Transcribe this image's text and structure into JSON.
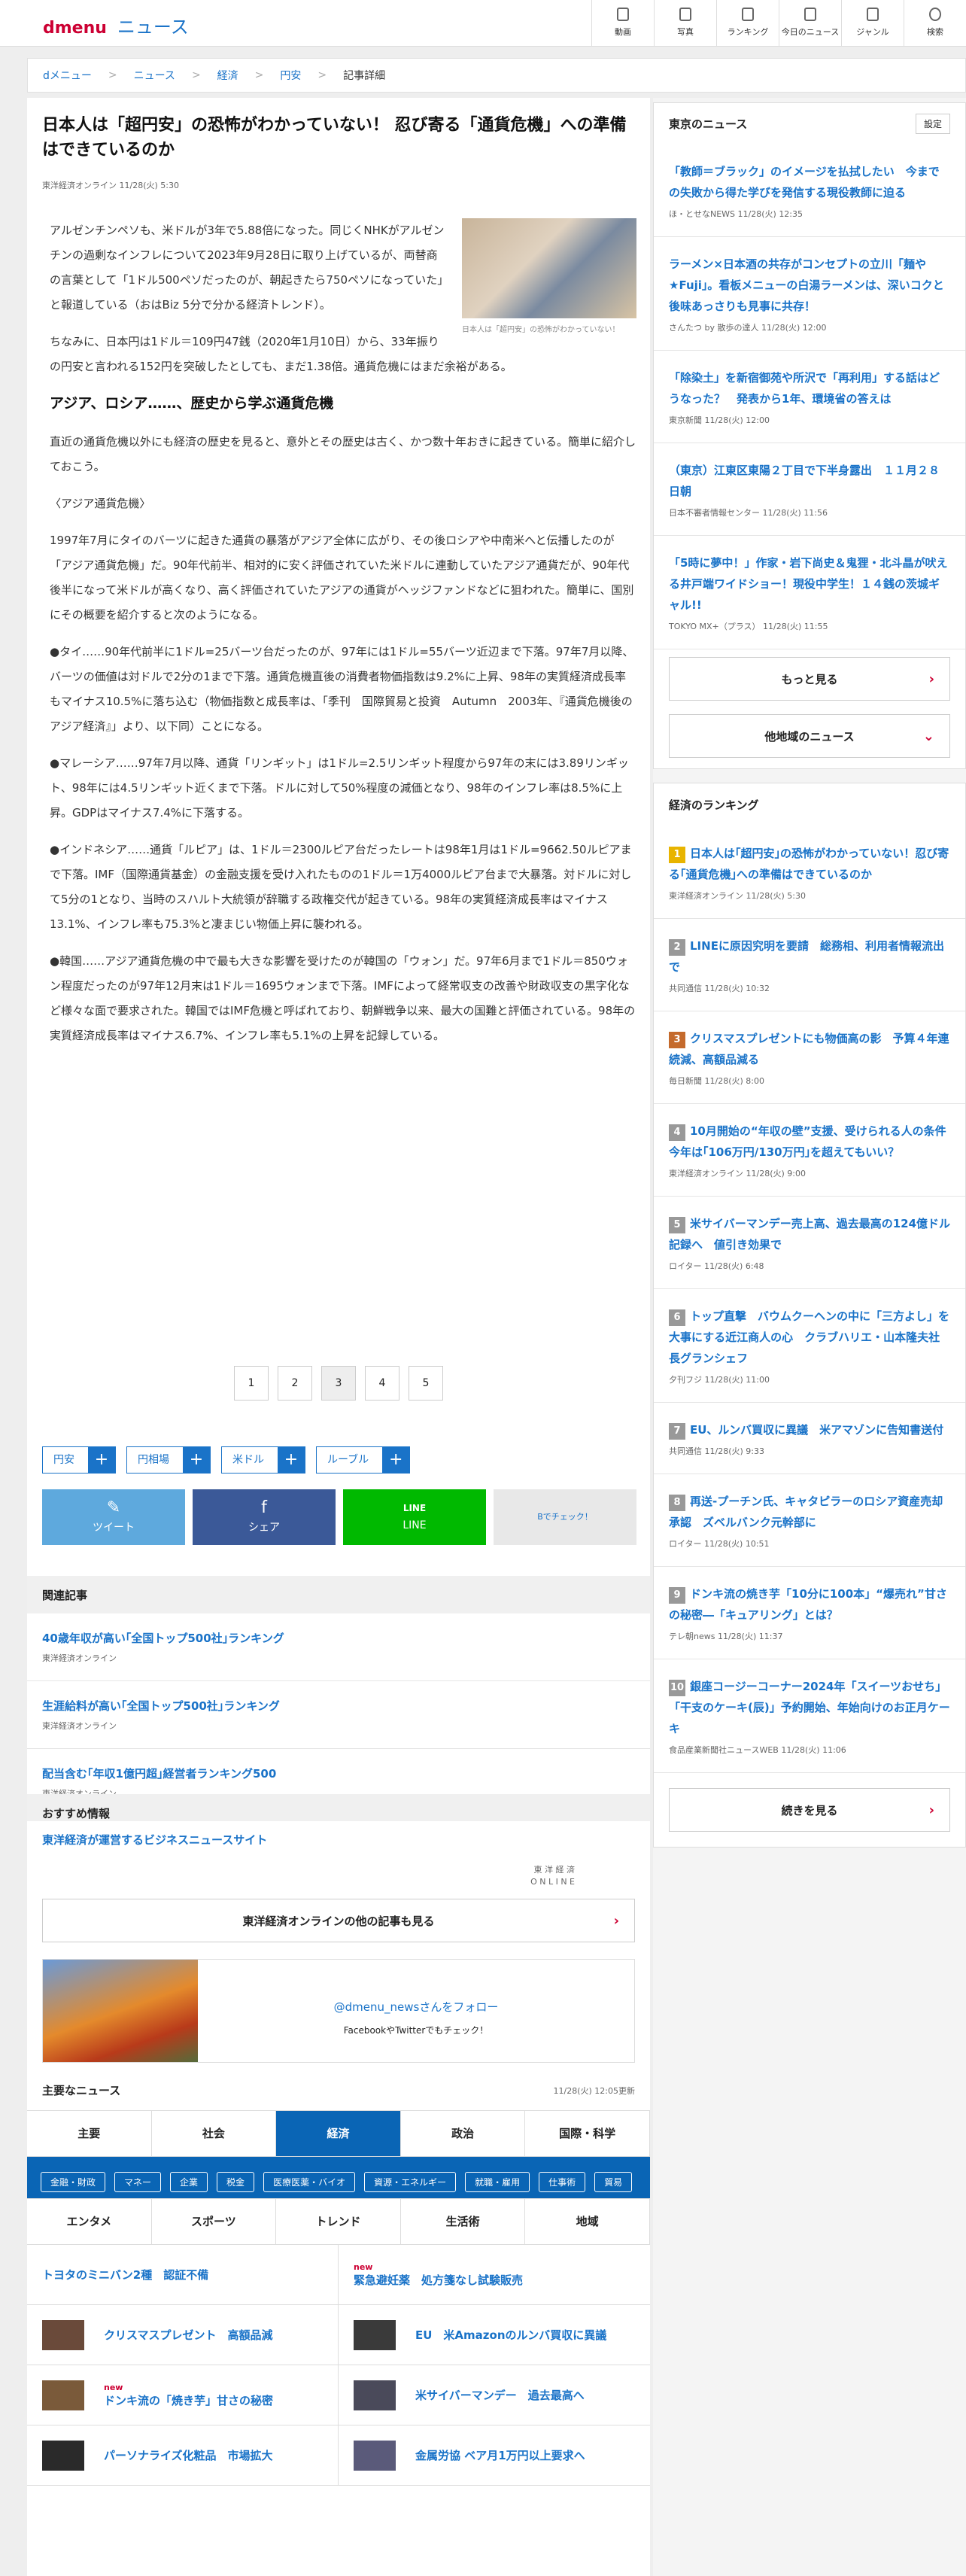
{
  "header": {
    "logo_d": "d",
    "logo_menu": "menu",
    "logo_news": "ニュース",
    "nav": [
      "動画",
      "写真",
      "ランキング",
      "今日のニュース",
      "ジャンル",
      "検索"
    ]
  },
  "breadcrumb": [
    "dメニュー",
    "ニュース",
    "経済",
    "円安",
    "記事詳細"
  ],
  "article": {
    "title": "日本人は「超円安」の恐怖がわかっていない！ 忍び寄る「通貨危機」への準備はできているのか",
    "source": "東洋経済オンライン 11/28(火) 5:30",
    "figcap": "日本人は「超円安」の恐怖がわかっていない！",
    "p1": "アルゼンチンペソも、米ドルが3年で5.88倍になった。同じくNHKがアルゼンチンの過剰なインフレについて2023年9月28日に取り上げているが、両替商の言葉として「1ドル500ペソだったのが、朝起きたら750ペソになっていた」と報道している（おはBiz 5分で分かる経済トレンド）。",
    "p2": "ちなみに、日本円は1ドル＝109円47銭（2020年1月10日）から、33年振りの円安と言われる152円を突破したとしても、まだ1.38倍。通貨危機にはまだ余裕がある。",
    "h2": "アジア、ロシア……、歴史から学ぶ通貨危機",
    "p3": "直近の通貨危機以外にも経済の歴史を見ると、意外とその歴史は古く、かつ数十年おきに起きている。簡単に紹介しておこう。",
    "p4": "〈アジア通貨危機〉",
    "p5": "1997年7月にタイのバーツに起きた通貨の暴落がアジア全体に広がり、その後ロシアや中南米へと伝播したのが「アジア通貨危機」だ。90年代前半、相対的に安く評価されていた米ドルに連動していたアジア通貨だが、90年代後半になって米ドルが高くなり、高く評価されていたアジアの通貨がヘッジファンドなどに狙われた。簡単に、国別にその概要を紹介すると次のようになる。",
    "p6": "●タイ……90年代前半に1ドル=25バーツ台だったのが、97年には1ドル=55バーツ近辺まで下落。97年7月以降、バーツの価値は対ドルで2分の1まで下落。通貨危機直後の消費者物価指数は9.2%に上昇、98年の実質経済成長率もマイナス10.5%に落ち込む（物価指数と成長率は、「季刊　国際貿易と投資　Autumn　2003年、『通貨危機後のアジア経済』」より、以下同）ことになる。",
    "p7": "●マレーシア……97年7月以降、通貨「リンギット」は1ドル=2.5リンギット程度から97年の末には3.89リンギット、98年には4.5リンギット近くまで下落。ドルに対して50%程度の減価となり、98年のインフレ率は8.5%に上昇。GDPはマイナス7.4%に下落する。",
    "p8": "●インドネシア……通貨「ルピア」は、1ドル＝2300ルピア台だったレートは98年1月は1ドル=9662.50ルピアまで下落。IMF（国際通貨基金）の金融支援を受け入れたものの1ドル＝1万4000ルピア台まで大暴落。対ドルに対して5分の1となり、当時のスハルト大統領が辞職する政権交代が起きている。98年の実質経済成長率はマイナス13.1%、インフレ率も75.3%と凄まじい物価上昇に襲われる。",
    "p9": "●韓国……アジア通貨危機の中で最も大きな影響を受けたのが韓国の「ウォン」だ。97年6月まで1ドル＝850ウォン程度だったのが97年12月末は1ドル＝1695ウォンまで下落。IMFによって経常収支の改善や財政収支の黒字化など様々な面で要求された。韓国ではIMF危機と呼ばれており、朝鮮戦争以来、最大の国難と評価されている。98年の実質経済成長率はマイナス6.7%、インフレ率も5.1%の上昇を記録している。"
  },
  "pager": [
    "1",
    "2",
    "3",
    "4",
    "5"
  ],
  "tags": [
    "円安",
    "円相場",
    "米ドル",
    "ルーブル"
  ],
  "share": {
    "tweet": "ツイート",
    "share": "シェア",
    "line": "LINE",
    "check": "Bでチェック！",
    "line_glyph": "LINE"
  },
  "related": {
    "heading": "関連記事",
    "items": [
      {
        "title": "40歳年収が高い｢全国トップ500社｣ランキング",
        "src": "東洋経済オンライン"
      },
      {
        "title": "生涯給料が高い｢全国トップ500社｣ランキング",
        "src": "東洋経済オンライン"
      },
      {
        "title": "配当含む｢年収1億円超｣経営者ランキング500",
        "src": "東洋経済オンライン"
      }
    ]
  },
  "reco": {
    "heading": "おすすめ情報",
    "link": "東洋経済が運営するビジネスニュースサイト",
    "logo": "東 洋 経 済\nO N L I N E",
    "more": "東洋経済オンラインの他の記事も見る",
    "follow": "@dmenu_newsさんをフォロー",
    "follow_sub": "FacebookやTwitterでもチェック！"
  },
  "major": {
    "heading": "主要なニュース",
    "updated": "11/28(火) 12:05更新",
    "cats1": [
      "主要",
      "社会",
      "経済",
      "政治",
      "国際・科学"
    ],
    "subtags": [
      "金融・財政",
      "マネー",
      "企業",
      "税金",
      "医療医薬・バイオ",
      "資源・エネルギー",
      "就職・雇用",
      "仕事術",
      "貿易"
    ],
    "cats2": [
      "エンタメ",
      "スポーツ",
      "トレンド",
      "生活術",
      "地域"
    ],
    "news": [
      {
        "t": "トヨタのミニバン2種　認証不備",
        "n": ""
      },
      {
        "t": "緊急避妊薬　処方箋なし試験販売",
        "n": "new"
      },
      {
        "t": "クリスマスプレゼント　高額品減",
        "n": ""
      },
      {
        "t": "EU　米Amazonのルンバ買収に異議",
        "n": ""
      },
      {
        "t": "ドンキ流の「焼き芋」甘さの秘密",
        "n": "new"
      },
      {
        "t": "米サイバーマンデー　過去最高へ",
        "n": ""
      },
      {
        "t": "パーソナライズ化粧品　市場拡大",
        "n": ""
      },
      {
        "t": "金属労協 ベア月1万円以上要求へ",
        "n": ""
      }
    ]
  },
  "side": {
    "tokyo_heading": "東京のニュース",
    "setting": "設定",
    "tokyo": [
      {
        "t": "「教師＝ブラック」のイメージを払拭したい　今までの失敗から得た学びを発信する現役教師に迫る",
        "s": "ほ・とせなNEWS 11/28(火) 12:35"
      },
      {
        "t": "ラーメン×日本酒の共存がコンセプトの立川「麺や★Fuji」。看板メニューの白湯ラーメンは、深いコクと後味あっさりも見事に共存！",
        "s": "さんたつ by 散歩の達人 11/28(火) 12:00"
      },
      {
        "t": "「除染土」を新宿御苑や所沢で「再利用」する話はどうなった？　発表から1年、環境省の答えは",
        "s": "東京新聞 11/28(火) 12:00"
      },
      {
        "t": "（東京）江東区東陽２丁目で下半身露出　１１月２８日朝",
        "s": "日本不審者情報センター 11/28(火) 11:56"
      },
      {
        "t": "「5時に夢中！」作家・岩下尚史＆鬼狸・北斗晶が吠える井戸端ワイドショー！現役中学生！１４銭の茨城ギャル!!",
        "s": "TOKYO MX+（プラス） 11/28(火) 11:55"
      }
    ],
    "more": "もっと見る",
    "other": "他地域のニュース",
    "rank_heading": "経済のランキング",
    "rank": [
      {
        "t": "日本人は｢超円安｣の恐怖がわかっていない！忍び寄る｢通貨危機｣への準備はできているのか",
        "s": "東洋経済オンライン 11/28(火) 5:30",
        "c": "#e8b400"
      },
      {
        "t": "LINEに原因究明を要請　総務相、利用者情報流出で",
        "s": "共同通信 11/28(火) 10:32",
        "c": "#999999"
      },
      {
        "t": "クリスマスプレゼントにも物価高の影　予算４年連続減、高額品減る",
        "s": "毎日新聞 11/28(火) 8:00",
        "c": "#c46a2c"
      },
      {
        "t": "10月開始の“年収の壁”支援、受けられる人の条件 今年は｢106万円/130万円｣を超えてもいい？",
        "s": "東洋経済オンライン 11/28(火) 9:00",
        "c": "#999999"
      },
      {
        "t": "米サイバーマンデー売上高、過去最高の124億ドル記録へ　値引き効果で",
        "s": "ロイター 11/28(火) 6:48",
        "c": "#999999"
      },
      {
        "t": "トップ直撃　バウムクーヘンの中に「三方よし」を大事にする近江商人の心　クラブハリエ・山本隆夫社長グランシェフ",
        "s": "夕刊フジ 11/28(火) 11:00",
        "c": "#999999"
      },
      {
        "t": "EU、ルンバ買収に異議　米アマゾンに告知書送付",
        "s": "共同通信 11/28(火) 9:33",
        "c": "#999999"
      },
      {
        "t": "再送-プーチン氏、キャタピラーのロシア資産売却承認　ズベルバンク元幹部に",
        "s": "ロイター 11/28(火) 10:51",
        "c": "#999999"
      },
      {
        "t": "ドンキ流の焼き芋「10分に100本」“爆売れ”甘さの秘密―「キュアリング」とは？",
        "s": "テレ朝news 11/28(火) 11:37",
        "c": "#999999"
      },
      {
        "t": "銀座コージーコーナー2024年「スイーツおせち」「干支のケーキ(辰)」予約開始、年始向けのお正月ケーキ",
        "s": "食品産業新聞社ニュースWEB 11/28(火) 11:06",
        "c": "#999999"
      }
    ],
    "rank_more": "続きを見る"
  }
}
